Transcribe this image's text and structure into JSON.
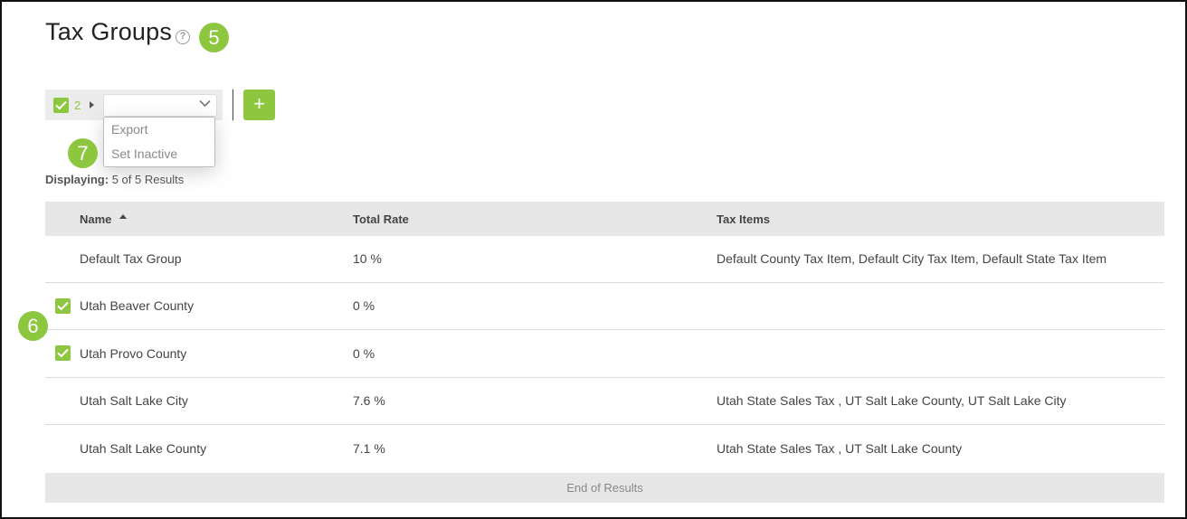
{
  "page": {
    "title": "Tax Groups",
    "help_icon": "question-circle-icon"
  },
  "callouts": [
    "5",
    "6",
    "7"
  ],
  "toolbar": {
    "selected_count": "2",
    "bulk_action_value": "",
    "bulk_actions": [
      "Export",
      "Set Inactive"
    ],
    "add_label": "+"
  },
  "results": {
    "label": "Displaying:",
    "value": "5 of 5 Results",
    "end_label": "End of Results"
  },
  "table": {
    "columns": [
      "Name",
      "Total Rate",
      "Tax Items"
    ],
    "sort_column": "Name",
    "rows": [
      {
        "name": "Default Tax Group",
        "rate": "10 %",
        "items": "Default County Tax Item, Default City Tax Item, Default State Tax Item",
        "checked": false
      },
      {
        "name": "Utah Beaver County",
        "rate": "0 %",
        "items": "",
        "checked": true
      },
      {
        "name": "Utah Provo County",
        "rate": "0 %",
        "items": "",
        "checked": true
      },
      {
        "name": "Utah Salt Lake City",
        "rate": "7.6 %",
        "items": "Utah State Sales Tax , UT Salt Lake County, UT Salt Lake City",
        "checked": false
      },
      {
        "name": "Utah Salt Lake County",
        "rate": "7.1 %",
        "items": "Utah State Sales Tax , UT Salt Lake County",
        "checked": false
      }
    ]
  },
  "colors": {
    "accent": "#8dc63f",
    "header_bg": "#e7e7e7"
  }
}
